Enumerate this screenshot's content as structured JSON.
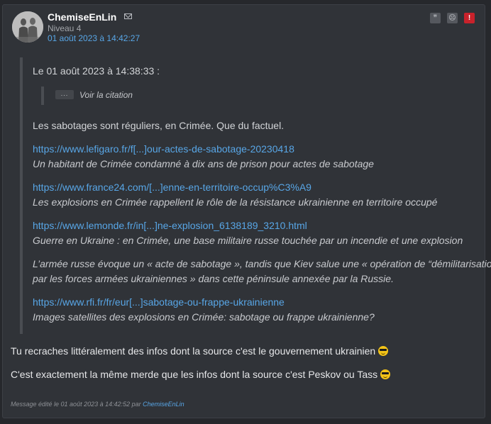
{
  "header": {
    "pseudo": "ChemiseEnLin",
    "niveau": "Niveau 4",
    "date": "01 août 2023 à 14:42:27",
    "icons": [
      "mail-icon",
      "quote-icon",
      "sad-face-icon",
      "alert-icon"
    ],
    "alert_color": "#c8222b"
  },
  "quote": {
    "header": "Le 01 août 2023 à 14:38:33 :",
    "voir_label": "Voir la citation",
    "dots": "...",
    "intro": "Les sabotages sont réguliers, en Crimée. Que du factuel.",
    "links": [
      {
        "url": "https://www.lefigaro.fr/f[...]our-actes-de-sabotage-20230418",
        "desc": "Un habitant de Crimée condamné à dix ans de prison pour actes de sabotage"
      },
      {
        "url": "https://www.france24.com/[...]enne-en-territoire-occup%C3%A9",
        "desc": "Les explosions en Crimée rappellent le rôle de la résistance ukrainienne en territoire occupé"
      },
      {
        "url": "https://www.lemonde.fr/in[...]ne-explosion_6138189_3210.html",
        "desc": "Guerre en Ukraine : en Crimée, une base militaire russe touchée par un incendie et une explosion"
      }
    ],
    "italic_para": [
      "L’armée russe évoque un « acte de sabotage », tandis que Kiev salue une « opération de “démilitarisation”",
      "par les forces armées ukrainiennes » dans cette péninsule annexée par la Russie."
    ],
    "last_link": {
      "url": "https://www.rfi.fr/fr/eur[...]sabotage-ou-frappe-ukrainienne",
      "desc": "Images satellites des explosions en Crimée: sabotage ou frappe ukrainienne?"
    }
  },
  "body": [
    "Tu recraches littéralement des infos dont la source c'est le gouvernement ukrainien",
    "C'est exactement la même merde que les infos dont la source c'est Peskov ou Tass"
  ],
  "footer": {
    "edited_text": "Message édité le 01 août 2023 à 14:42:52 par",
    "edited_by": "ChemiseEnLin"
  }
}
